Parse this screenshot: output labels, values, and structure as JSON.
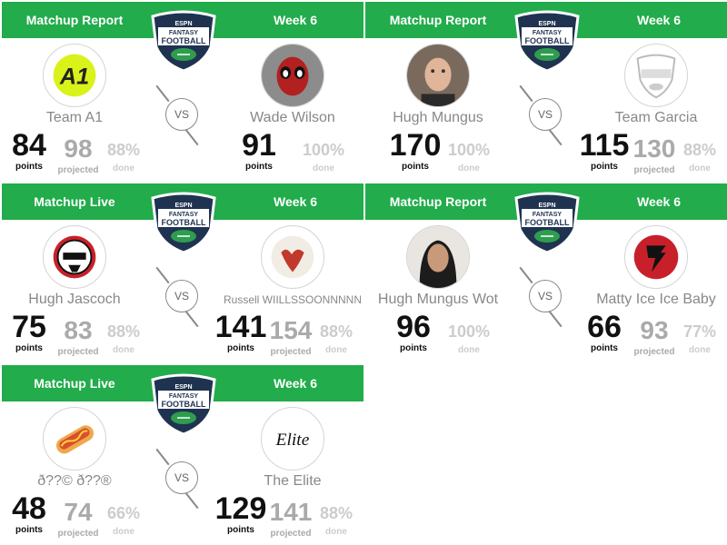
{
  "cards": [
    {
      "title": "Matchup Report",
      "week": "Week 6",
      "vs": "VS",
      "left": {
        "name": "Team A1",
        "points": "84",
        "projected": "98",
        "done": "88%",
        "avatar_icon": "a1-logo-icon"
      },
      "right": {
        "name": "Wade Wilson",
        "points": "91",
        "done": "100%",
        "avatar_icon": "deadpool-avatar-icon"
      }
    },
    {
      "title": "Matchup Report",
      "week": "Week 6",
      "vs": "VS",
      "left": {
        "name": "Hugh Mungus",
        "points": "170",
        "done": "100%",
        "avatar_icon": "person-photo-icon"
      },
      "right": {
        "name": "Team Garcia",
        "points": "115",
        "projected": "130",
        "done": "88%",
        "avatar_icon": "fantasy-football-logo-icon"
      }
    },
    {
      "title": "Matchup Live",
      "week": "Week 6",
      "vs": "VS",
      "left": {
        "name": "Hugh Jascoch",
        "points": "75",
        "projected": "83",
        "done": "88%",
        "avatar_icon": "stormtrooper-icon"
      },
      "right": {
        "name": "Russell WIILLSSOONNNNN",
        "points": "141",
        "projected": "154",
        "done": "88%",
        "avatar_icon": "volleyball-wilson-icon"
      }
    },
    {
      "title": "Matchup Report",
      "week": "Week 6",
      "vs": "VS",
      "left": {
        "name": "Hugh Mungus Wot",
        "points": "96",
        "done": "100%",
        "avatar_icon": "person-photo-icon"
      },
      "right": {
        "name": "Matty Ice Ice Baby",
        "points": "66",
        "projected": "93",
        "done": "77%",
        "avatar_icon": "falcons-logo-icon"
      }
    },
    {
      "title": "Matchup Live",
      "week": "Week 6",
      "vs": "VS",
      "left": {
        "name": "ð??© ð??®",
        "points": "48",
        "projected": "74",
        "done": "66%",
        "avatar_icon": "hotdog-icon"
      },
      "right": {
        "name": "The Elite",
        "points": "129",
        "projected": "141",
        "done": "88%",
        "avatar_icon": "elite-logo-icon"
      }
    }
  ],
  "labels": {
    "points": "points",
    "projected": "projected",
    "done": "done"
  },
  "colors": {
    "header_green": "#22ac4b",
    "shield_navy": "#1f3351",
    "shield_green": "#2e9d4e"
  }
}
